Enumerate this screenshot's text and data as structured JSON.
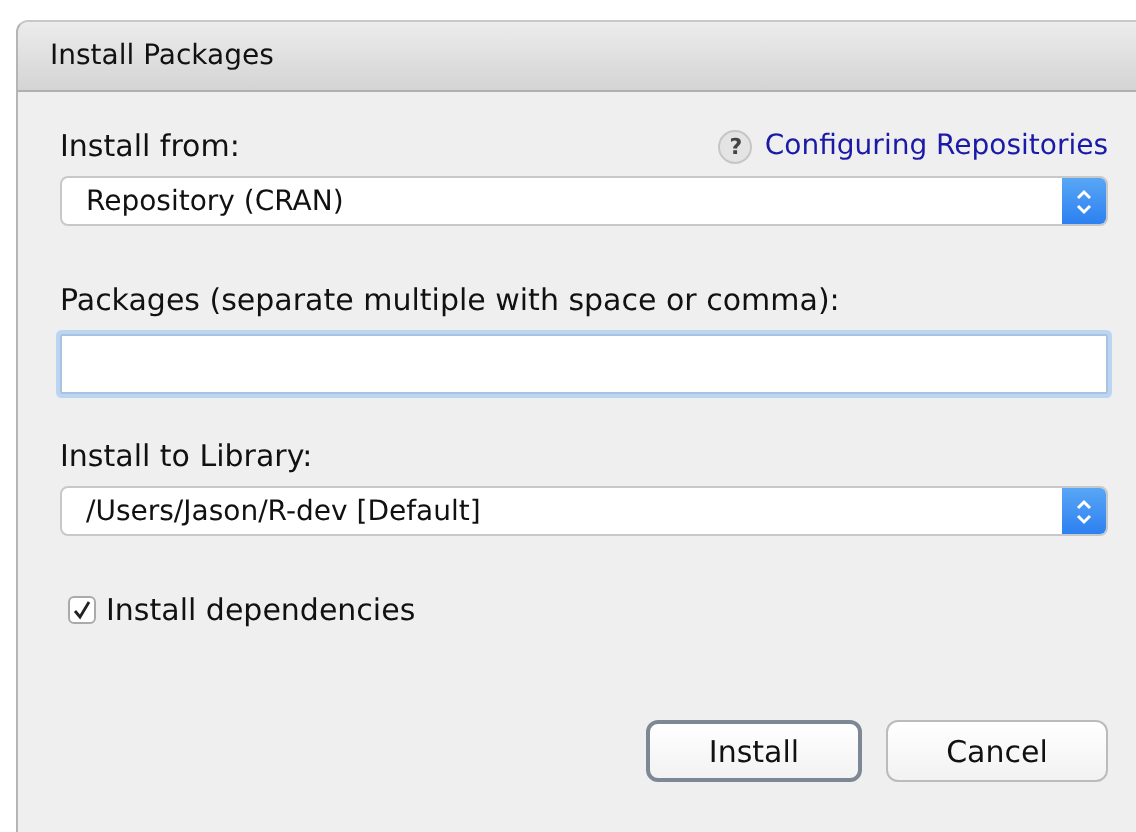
{
  "window": {
    "title": "Install Packages"
  },
  "install_from": {
    "label": "Install from:",
    "help_link": "Configuring Repositories",
    "help_icon": "?",
    "value": "Repository (CRAN)"
  },
  "packages": {
    "label": "Packages (separate multiple with space or comma):"
  },
  "library": {
    "label": "Install to Library:",
    "value": "/Users/Jason/R-dev [Default]"
  },
  "dependencies": {
    "label": "Install dependencies",
    "checked": true
  },
  "buttons": [
    {
      "label": "Install",
      "default": true
    },
    {
      "label": "Cancel",
      "default": false
    }
  ]
}
